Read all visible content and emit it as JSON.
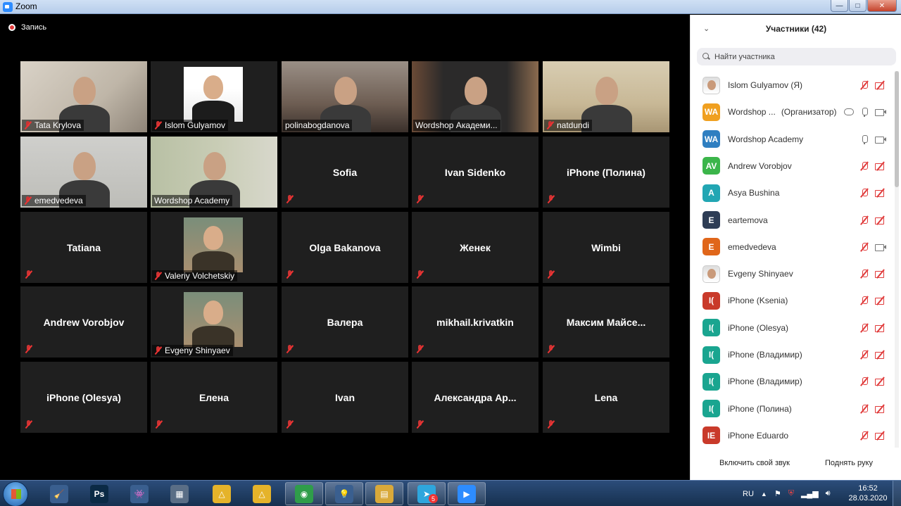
{
  "window": {
    "title": "Zoom",
    "minimize": "—",
    "maximize": "□",
    "close": "✕"
  },
  "recording": {
    "label": "Запись"
  },
  "tiles": [
    {
      "name": "Tata Krylova",
      "mode": "video"
    },
    {
      "name": "Islom Gulyamov",
      "mode": "photo"
    },
    {
      "name": "polinabogdanova",
      "mode": "video"
    },
    {
      "name": "Wordshop Академи...",
      "mode": "video"
    },
    {
      "name": "natdundi",
      "mode": "video"
    },
    {
      "name": "emedvedeva",
      "mode": "video"
    },
    {
      "name": "Wordshop Academy",
      "mode": "video",
      "active": true
    },
    {
      "name": "Sofia",
      "mode": "name"
    },
    {
      "name": "Ivan Sidenko",
      "mode": "name"
    },
    {
      "name": "iPhone (Полина)",
      "mode": "name"
    },
    {
      "name": "Tatiana",
      "mode": "name"
    },
    {
      "name": "Valeriy Volchetskiy",
      "mode": "photo"
    },
    {
      "name": "Olga Bakanova",
      "mode": "name"
    },
    {
      "name": "Женек",
      "mode": "name"
    },
    {
      "name": "Wimbi",
      "mode": "name"
    },
    {
      "name": "Andrew Vorobjov",
      "mode": "name"
    },
    {
      "name": "Evgeny Shinyaev",
      "mode": "photo"
    },
    {
      "name": "Валера",
      "mode": "name"
    },
    {
      "name": "mikhail.krivatkin",
      "mode": "name"
    },
    {
      "name": "Максим  Майсе...",
      "mode": "name"
    },
    {
      "name": "iPhone (Olesya)",
      "mode": "name"
    },
    {
      "name": "Елена",
      "mode": "name"
    },
    {
      "name": "Ivan",
      "mode": "name"
    },
    {
      "name": "Александра  Ар...",
      "mode": "name"
    },
    {
      "name": "Lena",
      "mode": "name"
    }
  ],
  "participants_panel": {
    "title": "Участники (42)",
    "search_placeholder": "Найти участника",
    "items": [
      {
        "name": "Islom Gulyamov (Я)",
        "avatar": "",
        "avatar_color": "photo",
        "mic": "off",
        "cam": "off"
      },
      {
        "name": "Wordshop ...",
        "role": "(Организатор)",
        "avatar": "WA",
        "avatar_color": "#f0a020",
        "mic": "on",
        "cam": "on",
        "share": true
      },
      {
        "name": "Wordshop Academy",
        "avatar": "WA",
        "avatar_color": "#2f7fc1",
        "mic": "on",
        "cam": "on"
      },
      {
        "name": "Andrew Vorobjov",
        "avatar": "AV",
        "avatar_color": "#3bb54a",
        "mic": "off",
        "cam": "off"
      },
      {
        "name": "Asya Bushina",
        "avatar": "A",
        "avatar_color": "#22a6b3",
        "mic": "off",
        "cam": "off"
      },
      {
        "name": "eartemova",
        "avatar": "E",
        "avatar_color": "#2e3d55",
        "mic": "off",
        "cam": "off"
      },
      {
        "name": "emedvedeva",
        "avatar": "E",
        "avatar_color": "#e0661a",
        "mic": "off",
        "cam": "on"
      },
      {
        "name": "Evgeny Shinyaev",
        "avatar": "",
        "avatar_color": "photo",
        "mic": "off",
        "cam": "off"
      },
      {
        "name": "iPhone (Ksenia)",
        "avatar": "I(",
        "avatar_color": "#c93a2a",
        "mic": "off",
        "cam": "off"
      },
      {
        "name": "iPhone (Olesya)",
        "avatar": "I(",
        "avatar_color": "#1aa590",
        "mic": "off",
        "cam": "off"
      },
      {
        "name": "iPhone (Владимир)",
        "avatar": "I(",
        "avatar_color": "#1aa590",
        "mic": "off",
        "cam": "off"
      },
      {
        "name": "iPhone (Владимир)",
        "avatar": "I(",
        "avatar_color": "#1aa590",
        "mic": "off",
        "cam": "off"
      },
      {
        "name": "iPhone (Полина)",
        "avatar": "I(",
        "avatar_color": "#1aa590",
        "mic": "off",
        "cam": "off"
      },
      {
        "name": "iPhone Eduardo",
        "avatar": "IE",
        "avatar_color": "#c93a2a",
        "mic": "off",
        "cam": "off"
      }
    ],
    "unmute_label": "Включить свой звук",
    "raise_hand_label": "Поднять руку"
  },
  "taskbar": {
    "apps": [
      {
        "icon": "cleaner-icon",
        "glyph": "🧹",
        "color": "#3a5f8f"
      },
      {
        "icon": "photoshop-icon",
        "glyph": "Ps",
        "color": "#0b2a45"
      },
      {
        "icon": "game-icon",
        "glyph": "👾",
        "color": "#3a5f8f"
      },
      {
        "icon": "calculator-icon",
        "glyph": "▦",
        "color": "#5a6e86"
      },
      {
        "icon": "delta-icon",
        "glyph": "△",
        "color": "#e5b32a"
      },
      {
        "icon": "delta2-icon",
        "glyph": "△",
        "color": "#e5b32a"
      },
      {
        "icon": "chrome-icon",
        "glyph": "◉",
        "color": "#2f9d4a"
      },
      {
        "icon": "tips-icon",
        "glyph": "💡",
        "color": "#3a5f8f"
      },
      {
        "icon": "explorer-icon",
        "glyph": "▤",
        "color": "#d9a93a"
      },
      {
        "icon": "telegram-icon",
        "glyph": "➤",
        "color": "#2ea6dd"
      },
      {
        "icon": "zoom-icon",
        "glyph": "▶",
        "color": "#2d8cff"
      }
    ],
    "telegram_badge": "5",
    "lang": "RU",
    "time": "16:52",
    "date": "28.03.2020"
  }
}
